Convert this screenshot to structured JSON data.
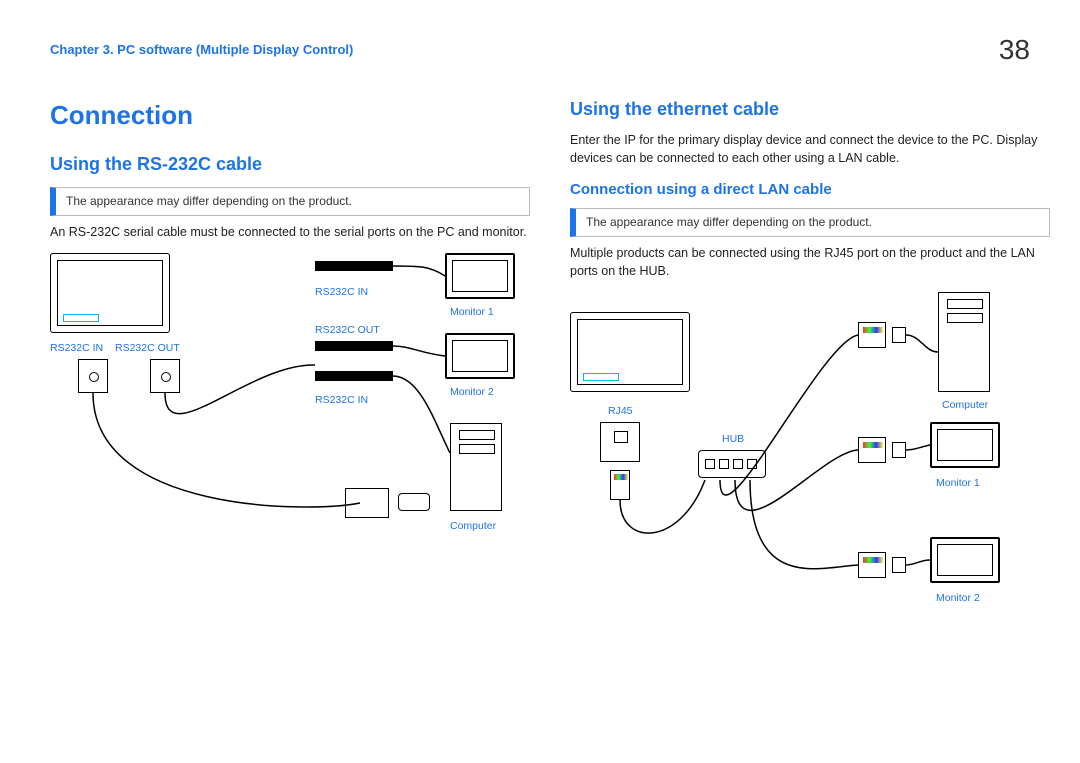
{
  "header": {
    "chapter": "Chapter 3. PC software (Multiple Display Control)",
    "page_number": "38"
  },
  "left": {
    "title": "Connection",
    "subtitle": "Using the RS-232C cable",
    "note": "The appearance may differ depending on the product.",
    "body": "An RS-232C serial cable must be connected to the serial ports on the PC and monitor.",
    "diagram_labels": {
      "rs232c_in": "RS232C IN",
      "rs232c_out": "RS232C OUT",
      "monitor1": "Monitor 1",
      "monitor2": "Monitor 2",
      "computer": "Computer"
    }
  },
  "right": {
    "subtitle": "Using the ethernet cable",
    "body1": "Enter the IP for the primary display device and connect the device to the PC. Display devices can be connected to each other using a LAN cable.",
    "subsub": "Connection using a direct LAN cable",
    "note": "The appearance may differ depending on the product.",
    "body2": "Multiple products can be connected using the RJ45 port on the product and the LAN ports on the HUB.",
    "diagram_labels": {
      "rj45": "RJ45",
      "hub": "HUB",
      "computer": "Computer",
      "monitor1": "Monitor 1",
      "monitor2": "Monitor 2"
    }
  }
}
